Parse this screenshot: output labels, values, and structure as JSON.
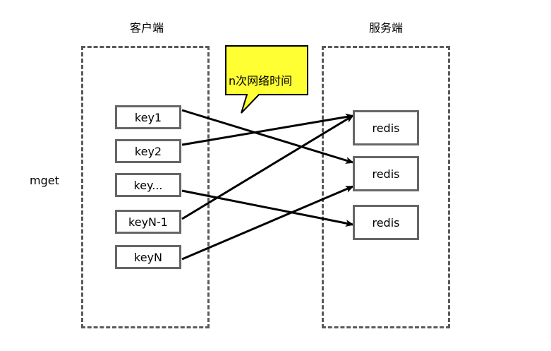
{
  "client_title": "客户端",
  "server_title": "服务端",
  "side_label": "mget",
  "callout": "n次网络时间",
  "keys": [
    "key1",
    "key2",
    "key...",
    "keyN-1",
    "keyN"
  ],
  "redis_nodes": [
    "redis",
    "redis",
    "redis"
  ],
  "colors": {
    "callout_fill": "#ffff33",
    "box_border": "#666666",
    "dash_border": "#5a5a5a",
    "arrow": "#000000"
  }
}
